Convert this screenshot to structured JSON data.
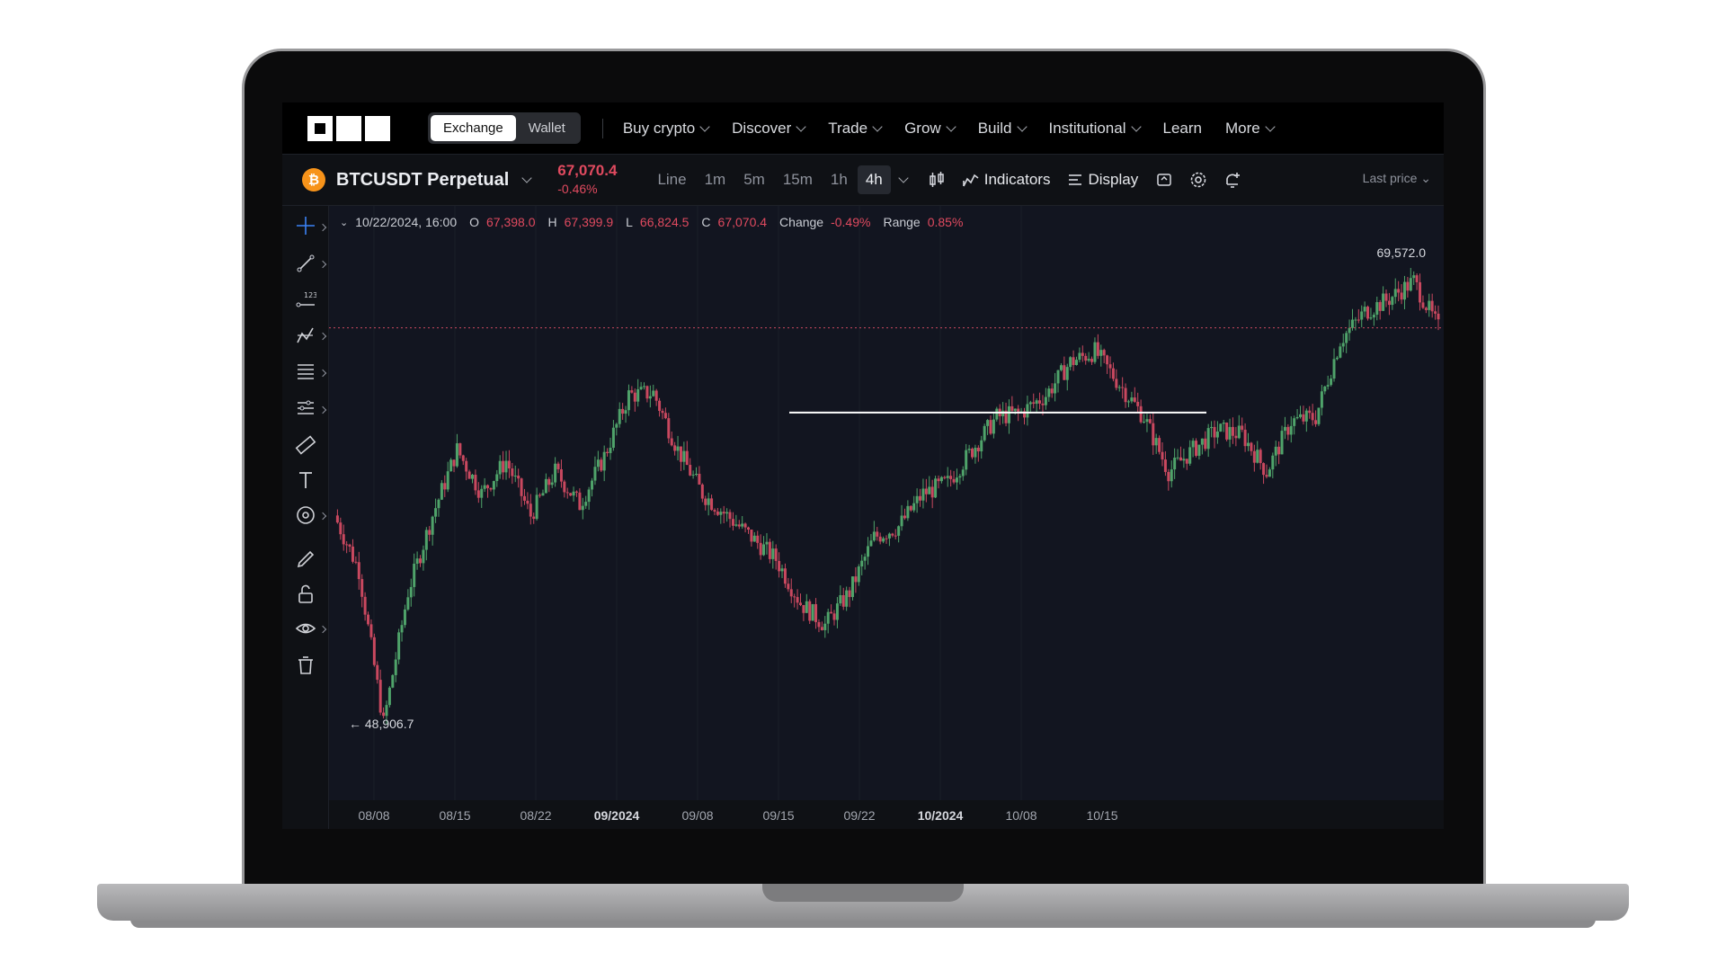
{
  "nav": {
    "exchange_label": "Exchange",
    "wallet_label": "Wallet",
    "items": [
      {
        "label": "Buy crypto",
        "dropdown": true
      },
      {
        "label": "Discover",
        "dropdown": true
      },
      {
        "label": "Trade",
        "dropdown": true
      },
      {
        "label": "Grow",
        "dropdown": true
      },
      {
        "label": "Build",
        "dropdown": true
      },
      {
        "label": "Institutional",
        "dropdown": true
      },
      {
        "label": "Learn",
        "dropdown": false
      },
      {
        "label": "More",
        "dropdown": true
      }
    ]
  },
  "instrument": {
    "symbol": "BTCUSDT Perpetual",
    "coin_glyph": "₿",
    "price": "67,070.4",
    "change": "-0.46%"
  },
  "timeframes": [
    "Line",
    "1m",
    "5m",
    "15m",
    "1h",
    "4h"
  ],
  "active_timeframe": "4h",
  "toolbar": {
    "indicators_label": "Indicators",
    "display_label": "Display",
    "last_price_label": "Last price"
  },
  "ohlc": {
    "datetime": "10/22/2024, 16:00",
    "o_label": "O",
    "o": "67,398.0",
    "h_label": "H",
    "h": "67,399.9",
    "l_label": "L",
    "l": "66,824.5",
    "c_label": "C",
    "c": "67,070.4",
    "change_label": "Change",
    "change": "-0.49%",
    "range_label": "Range",
    "range": "0.85%"
  },
  "chart_data": {
    "type": "line",
    "price_high_label": "69,572.0",
    "price_low_label": "← 48,906.7",
    "x_ticks": [
      {
        "label": "08/08",
        "bold": false
      },
      {
        "label": "08/15",
        "bold": false
      },
      {
        "label": "08/22",
        "bold": false
      },
      {
        "label": "09/2024",
        "bold": true
      },
      {
        "label": "09/08",
        "bold": false
      },
      {
        "label": "09/15",
        "bold": false
      },
      {
        "label": "09/22",
        "bold": false
      },
      {
        "label": "10/2024",
        "bold": true
      },
      {
        "label": "10/08",
        "bold": false
      },
      {
        "label": "10/15",
        "bold": false
      }
    ],
    "ylim": [
      48000,
      71000
    ],
    "x": [
      "08/06",
      "08/07",
      "08/08",
      "08/09",
      "08/10",
      "08/12",
      "08/13",
      "08/15",
      "08/17",
      "08/19",
      "08/21",
      "08/23",
      "08/24",
      "08/26",
      "08/27",
      "08/29",
      "08/31",
      "09/02",
      "09/04",
      "09/06",
      "09/07",
      "09/09",
      "09/11",
      "09/13",
      "09/15",
      "09/17",
      "09/19",
      "09/20",
      "09/22",
      "09/24",
      "09/26",
      "09/27",
      "09/29",
      "10/01",
      "10/02",
      "10/04",
      "10/06",
      "10/08",
      "10/10",
      "10/11",
      "10/13",
      "10/15",
      "10/16",
      "10/18",
      "10/20",
      "10/22"
    ],
    "values": [
      58500,
      56000,
      49000,
      55000,
      58500,
      61500,
      59500,
      61000,
      58500,
      60500,
      59000,
      61200,
      64000,
      64100,
      61500,
      59500,
      58500,
      57500,
      56500,
      54500,
      53500,
      55000,
      57500,
      58000,
      59500,
      60000,
      61500,
      63000,
      63200,
      64000,
      65500,
      66000,
      64500,
      63000,
      60500,
      61500,
      62400,
      62200,
      60500,
      62800,
      63000,
      66500,
      67800,
      68400,
      69200,
      67070
    ],
    "support_line": 63200,
    "series_colors": {
      "up": "#4fa36a",
      "down": "#c9485f"
    }
  }
}
